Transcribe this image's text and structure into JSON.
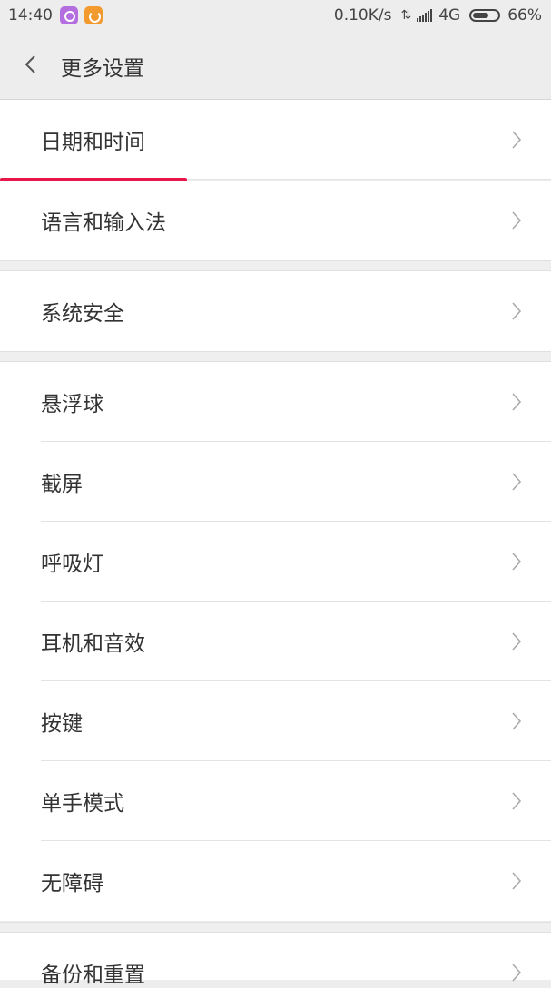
{
  "status_bar": {
    "time": "14:40",
    "net_speed": "0.10K/s",
    "network": "4G",
    "battery": "66%",
    "battery_level": 0.66,
    "app_icons": [
      "purple-app-icon",
      "orange-app-icon"
    ]
  },
  "header": {
    "back_icon": "chevron-left-icon",
    "title": "更多设置"
  },
  "accent_color": "#e8174a",
  "groups": [
    {
      "items": [
        {
          "label": "日期和时间"
        },
        {
          "label": "语言和输入法"
        }
      ]
    },
    {
      "items": [
        {
          "label": "系统安全"
        }
      ]
    },
    {
      "items": [
        {
          "label": "悬浮球"
        },
        {
          "label": "截屏"
        },
        {
          "label": "呼吸灯"
        },
        {
          "label": "耳机和音效"
        },
        {
          "label": "按键"
        },
        {
          "label": "单手模式"
        },
        {
          "label": "无障碍"
        }
      ]
    },
    {
      "items": [
        {
          "label": "备份和重置"
        }
      ]
    }
  ]
}
